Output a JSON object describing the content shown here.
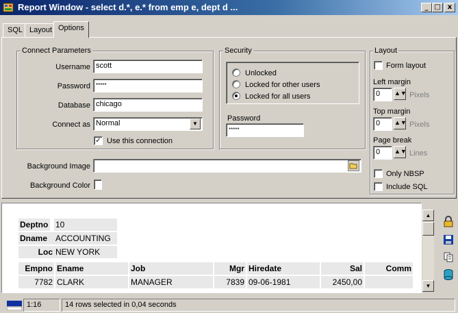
{
  "window": {
    "title": "Report Window - select d.*, e.*  from emp e, dept d  ...",
    "minimize": "_",
    "maximize": "□",
    "close": "x"
  },
  "tabs": [
    {
      "label": "SQL"
    },
    {
      "label": "Layout"
    },
    {
      "label": "Options",
      "active": true
    }
  ],
  "connect": {
    "group_title": "Connect Parameters",
    "username_label": "Username",
    "username_value": "scott",
    "password_label": "Password",
    "password_value": "*****",
    "database_label": "Database",
    "database_value": "chicago",
    "connect_as_label": "Connect as",
    "connect_as_value": "Normal",
    "use_connection_label": "Use this connection",
    "use_connection_checked": true
  },
  "security": {
    "group_title": "Security",
    "options": [
      {
        "label": "Unlocked",
        "selected": false
      },
      {
        "label": "Locked for other users",
        "selected": false
      },
      {
        "label": "Locked for all users",
        "selected": true
      }
    ],
    "password_label": "Password",
    "password_value": "*****"
  },
  "layout": {
    "group_title": "Layout",
    "form_layout_label": "Form layout",
    "left_margin_label": "Left margin",
    "left_margin_value": "0",
    "left_margin_unit": "Pixels",
    "top_margin_label": "Top margin",
    "top_margin_value": "0",
    "top_margin_unit": "Pixels",
    "page_break_label": "Page break",
    "page_break_value": "0",
    "page_break_unit": "Lines",
    "only_nbsp_label": "Only NBSP",
    "include_sql_label": "Include SQL"
  },
  "background": {
    "image_label": "Background Image",
    "image_value": "",
    "color_label": "Background Color"
  },
  "results": {
    "dept": [
      {
        "label": "Deptno",
        "value": "10"
      },
      {
        "label": "Dname",
        "value": "ACCOUNTING"
      },
      {
        "label": "Loc",
        "value": "NEW YORK"
      }
    ],
    "columns": [
      "Empno",
      "Ename",
      "Job",
      "Mgr",
      "Hiredate",
      "Sal",
      "Comm"
    ],
    "rows": [
      [
        "7782",
        "CLARK",
        "MANAGER",
        "7839",
        "09-06-1981",
        "2450,00",
        ""
      ]
    ]
  },
  "status": {
    "position": "1:16",
    "message": "14 rows selected in 0,04 seconds"
  },
  "icons": [
    "app-icon",
    "lock-icon",
    "save-icon",
    "copy-icon",
    "database-icon",
    "folder-icon"
  ]
}
